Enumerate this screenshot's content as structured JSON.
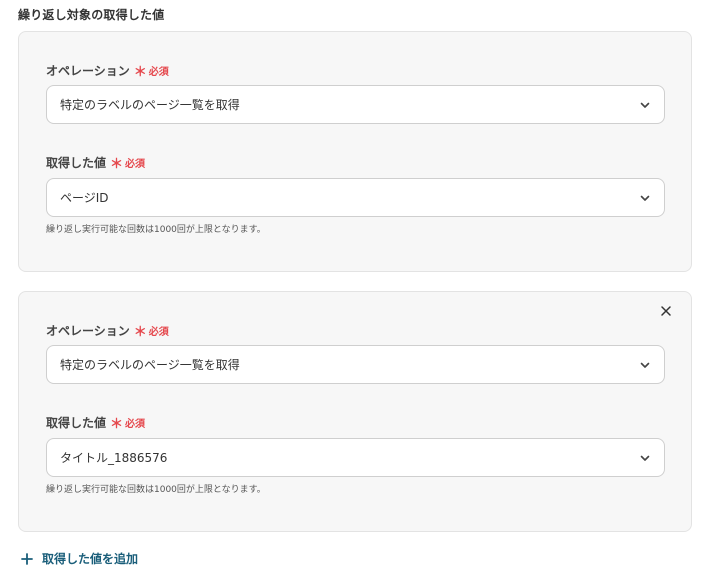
{
  "section_title": "繰り返し対象の取得した値",
  "required_mark": "＊",
  "required_text": "必須",
  "cards": [
    {
      "operation_label": "オペレーション",
      "operation_value": "特定のラベルのページ一覧を取得",
      "value_label": "取得した値",
      "value_value": "ページID",
      "helper": "繰り返し実行可能な回数は1000回が上限となります。",
      "closable": false
    },
    {
      "operation_label": "オペレーション",
      "operation_value": "特定のラベルのページ一覧を取得",
      "value_label": "取得した値",
      "value_value": "タイトル_1886576",
      "helper": "繰り返し実行可能な回数は1000回が上限となります。",
      "closable": true
    }
  ],
  "add_button_label": "取得した値を追加",
  "icons": {
    "chevron": "chevron-down-icon",
    "close": "close-icon",
    "add": "plus-icon"
  },
  "colors": {
    "required": "#e5484d",
    "link": "#1a5e7a",
    "card_bg": "#f7f7f7",
    "card_border": "#e3e3e3"
  }
}
